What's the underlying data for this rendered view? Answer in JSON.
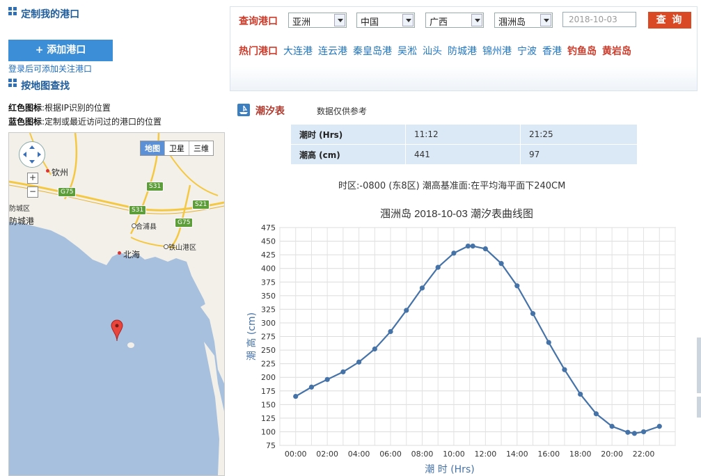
{
  "left": {
    "custom_ports_title": "定制我的港口",
    "add_port_button": "+ 添加港口",
    "login_hint": "登录后可添加关注港口",
    "map_search_title": "按地图查找",
    "legend_red_label": "红色图标",
    "legend_red_text": ":根据IP识别的位置",
    "legend_blue_label": "蓝色图标",
    "legend_blue_text": ":定制或最近访问过的港口的位置"
  },
  "map": {
    "types": [
      "地图",
      "卫星",
      "三维"
    ],
    "zoom_in": "+",
    "zoom_out": "−",
    "places": {
      "qinzhou": "钦州",
      "fang_district": "防城区",
      "fangchenggang": "防城港",
      "hepu": "合浦县",
      "beihai": "北海",
      "tieshangang": "铁山港区"
    },
    "roads": [
      "G75",
      "S31",
      "S21",
      "S31",
      "G75"
    ]
  },
  "query": {
    "label": "查询港口",
    "continent": "亚洲",
    "country": "中国",
    "province": "广西",
    "port": "涠洲岛",
    "date": "2018-10-03",
    "button": "查 询"
  },
  "hot_ports": {
    "label": "热门港口",
    "items": [
      "大连港",
      "连云港",
      "秦皇岛港",
      "吴淞",
      "汕头",
      "防城港",
      "锦州港",
      "宁波",
      "香港"
    ],
    "highlight": [
      "钓鱼岛",
      "黄岩岛"
    ]
  },
  "tide": {
    "section_title": "潮汐表",
    "disclaimer": "数据仅供参考",
    "row_time_label": "潮时 (Hrs)",
    "row_height_label": "潮高 (cm)",
    "times": [
      "11:12",
      "21:25"
    ],
    "heights": [
      "441",
      "97"
    ],
    "timezone_note": "时区:-0800 (东8区) 潮高基准面:在平均海平面下240CM"
  },
  "chart_data": {
    "type": "line",
    "title": "涠洲岛 2018-10-03 潮汐表曲线图",
    "xlabel": "潮 时 (Hrs)",
    "ylabel": "潮 高 (cm)",
    "ylim": [
      75,
      475
    ],
    "yticks": [
      75,
      100,
      125,
      150,
      175,
      200,
      225,
      250,
      275,
      300,
      325,
      350,
      375,
      400,
      425,
      450,
      475
    ],
    "xlim": [
      -1.0,
      24.0
    ],
    "xticks": [
      "00:00",
      "02:00",
      "04:00",
      "06:00",
      "08:00",
      "10:00",
      "12:00",
      "14:00",
      "16:00",
      "18:00",
      "20:00",
      "22:00"
    ],
    "grid": true,
    "color": "#4572a7",
    "series": [
      {
        "x": [
          0,
          1,
          2,
          3,
          4,
          5,
          6,
          7,
          8,
          9,
          10,
          10.9,
          11.2,
          12,
          13,
          14,
          15,
          16,
          17,
          18,
          19,
          20,
          21,
          21.42,
          22,
          23
        ],
        "values": [
          165,
          182,
          196,
          210,
          228,
          252,
          284,
          323,
          364,
          402,
          428,
          441,
          441,
          436,
          409,
          368,
          317,
          264,
          214,
          169,
          133,
          110,
          99,
          97,
          100,
          110
        ]
      }
    ]
  }
}
